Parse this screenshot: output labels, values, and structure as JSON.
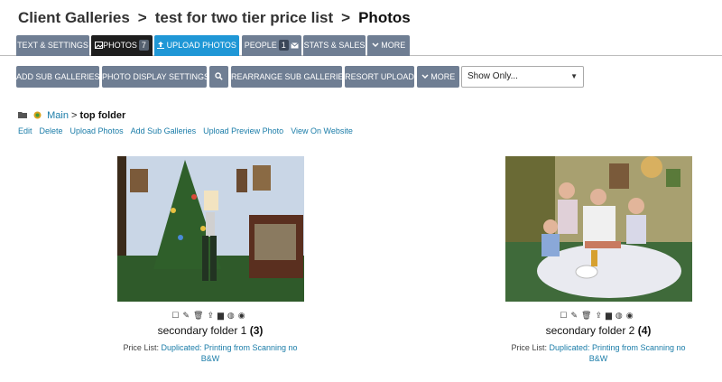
{
  "breadcrumb": {
    "root": "Client Galleries",
    "gallery": "test for two tier price list",
    "current": "Photos",
    "separator": ">"
  },
  "tabs": [
    {
      "label": "TEXT & SETTINGS"
    },
    {
      "label": "PHOTOS",
      "badge": "7",
      "icon": "gallery-icon"
    },
    {
      "label": "UPLOAD PHOTOS",
      "icon": "upload-icon"
    },
    {
      "label": "PEOPLE",
      "badge": "1",
      "icon": "mail-icon"
    },
    {
      "label": "STATS & SALES"
    },
    {
      "label": "MORE",
      "icon": "chevron-down-icon"
    }
  ],
  "toolbar": {
    "add_sub_galleries": "ADD SUB GALLERIES",
    "photo_display_settings": "PHOTO DISPLAY SETTINGS",
    "search_icon": "search-icon",
    "rearrange": "REARRANGE SUB GALLERIES",
    "resort_upload": "RESORT UPLOAD",
    "more": "MORE",
    "select_value": "Show Only..."
  },
  "folder": {
    "main": "Main",
    "current": "top folder",
    "separator": ">"
  },
  "actions": [
    "Edit",
    "Delete",
    "Upload Photos",
    "Add Sub Galleries",
    "Upload Preview Photo",
    "View On Website"
  ],
  "galleries": [
    {
      "title": "secondary folder 1",
      "count": "(3)",
      "price_label": "Price List:",
      "price_line1": "Duplicated: Printing from Scanning no",
      "price_line2": "B&W"
    },
    {
      "title": "secondary folder 2",
      "count": "(4)",
      "price_label": "Price List:",
      "price_line1": "Duplicated: Printing from Scanning no",
      "price_line2": "B&W"
    }
  ],
  "card_icons": [
    "checkbox-icon",
    "pencil-icon",
    "trash-icon",
    "upload-icon",
    "folder-icon",
    "globe-icon",
    "eye-icon"
  ],
  "colors": {
    "tab": "#6f7e93",
    "active_tab": "#1e1e1e",
    "upload_tab": "#1f97d6",
    "link": "#1a7ca8"
  }
}
